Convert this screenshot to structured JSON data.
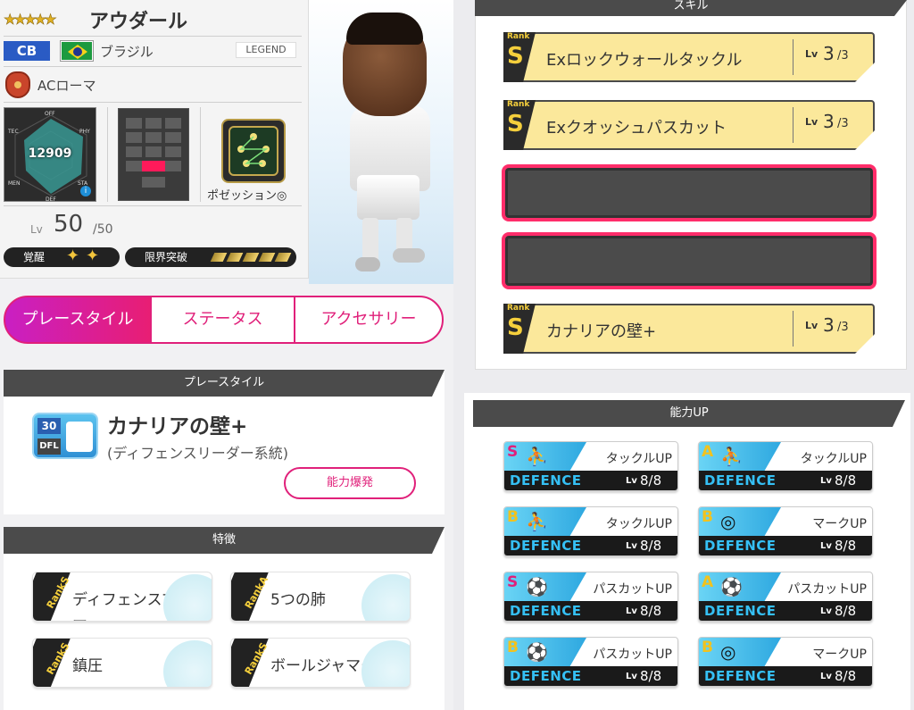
{
  "player": {
    "stars": "★★★★★",
    "name": "アウダール",
    "position": "CB",
    "nationality": "ブラジル",
    "rarity": "LEGEND",
    "club": "ACローマ",
    "overall": "12909",
    "radar_labels": [
      "OFF",
      "PHY",
      "STA",
      "DEF",
      "MEN",
      "TEC"
    ],
    "play_style_icon_label": "ポゼッション◎",
    "level_label": "Lv",
    "level": "50",
    "level_max": "/50",
    "awakening_label": "覚醒",
    "limit_break_label": "限界突破"
  },
  "tabs": [
    "プレースタイル",
    "ステータス",
    "アクセサリー"
  ],
  "playstyle": {
    "header": "プレースタイル",
    "badge_num": "30",
    "badge_code": "DFL",
    "title": "カナリアの壁+",
    "subtitle": "(ディフェンスリーダー系統)",
    "burst_button": "能力爆発"
  },
  "features": {
    "header": "特徴",
    "items": [
      {
        "rank": "RankS",
        "label": "ディフェンスマスター"
      },
      {
        "rank": "RankA",
        "label": "5つの肺"
      },
      {
        "rank": "RankS",
        "label": "鎮圧"
      },
      {
        "rank": "RankS",
        "label": "ボールジャマー"
      }
    ]
  },
  "skills": {
    "header": "スキル",
    "items": [
      {
        "rank_label": "Rank",
        "rank": "S",
        "name": "Exロックウォールタックル",
        "lv_label": "Lv",
        "lv": "3",
        "lv_max": "/3"
      },
      {
        "rank_label": "Rank",
        "rank": "S",
        "name": "Exクオッシュパスカット",
        "lv_label": "Lv",
        "lv": "3",
        "lv_max": "/3"
      },
      {
        "rank_label": "Rank",
        "rank": "S",
        "name": "カナリアの壁+",
        "lv_label": "Lv",
        "lv": "3",
        "lv_max": "/3"
      }
    ]
  },
  "ability_up": {
    "header": "能力UP",
    "items": [
      {
        "rank": "S",
        "name": "タックルUP",
        "category": "DEFENCE",
        "lv_label": "Lv",
        "lv": "8/8"
      },
      {
        "rank": "A",
        "name": "タックルUP",
        "category": "DEFENCE",
        "lv_label": "Lv",
        "lv": "8/8"
      },
      {
        "rank": "B",
        "name": "タックルUP",
        "category": "DEFENCE",
        "lv_label": "Lv",
        "lv": "8/8"
      },
      {
        "rank": "B",
        "name": "マークUP",
        "category": "DEFENCE",
        "lv_label": "Lv",
        "lv": "8/8"
      },
      {
        "rank": "S",
        "name": "パスカットUP",
        "category": "DEFENCE",
        "lv_label": "Lv",
        "lv": "8/8"
      },
      {
        "rank": "A",
        "name": "パスカットUP",
        "category": "DEFENCE",
        "lv_label": "Lv",
        "lv": "8/8"
      },
      {
        "rank": "B",
        "name": "パスカットUP",
        "category": "DEFENCE",
        "lv_label": "Lv",
        "lv": "8/8"
      },
      {
        "rank": "B",
        "name": "マークUP",
        "category": "DEFENCE",
        "lv_label": "Lv",
        "lv": "8/8"
      }
    ]
  },
  "colors": {
    "accent": "#e0207a",
    "skill_card": "#fbe89b",
    "defence_text": "#35c0f5"
  }
}
